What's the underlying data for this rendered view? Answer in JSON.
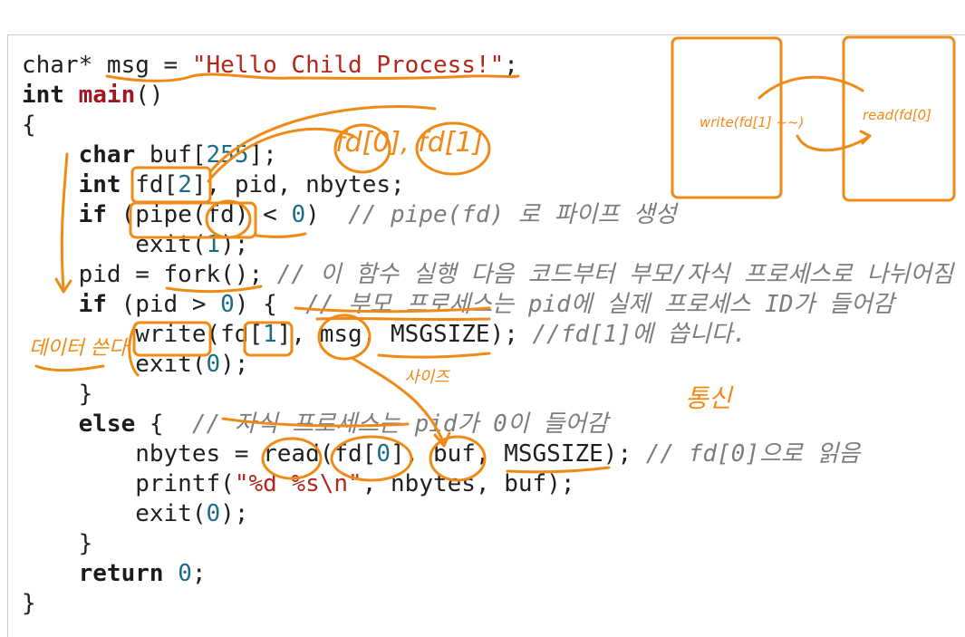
{
  "code_lines": [
    [
      {
        "t": "char* msg = ",
        "c": "kw0"
      },
      {
        "t": "\"Hello Child Process!\"",
        "c": "str"
      },
      {
        "t": ";",
        "c": ""
      }
    ],
    [
      {
        "t": "int ",
        "c": "kw"
      },
      {
        "t": "main",
        "c": "fn"
      },
      {
        "t": "()",
        "c": ""
      }
    ],
    [
      {
        "t": "{",
        "c": ""
      }
    ],
    [
      {
        "t": "    ",
        "c": ""
      },
      {
        "t": "char",
        "c": "kw"
      },
      {
        "t": " buf[",
        "c": ""
      },
      {
        "t": "255",
        "c": "num"
      },
      {
        "t": "];",
        "c": ""
      }
    ],
    [
      {
        "t": "    ",
        "c": ""
      },
      {
        "t": "int",
        "c": "kw"
      },
      {
        "t": " fd[",
        "c": ""
      },
      {
        "t": "2",
        "c": "num"
      },
      {
        "t": "], pid, nbytes;",
        "c": ""
      }
    ],
    [
      {
        "t": "    ",
        "c": ""
      },
      {
        "t": "if",
        "c": "kw"
      },
      {
        "t": " (pipe(fd) < ",
        "c": ""
      },
      {
        "t": "0",
        "c": "num"
      },
      {
        "t": ")  ",
        "c": ""
      },
      {
        "t": "// pipe(fd) 로 파이프 생성",
        "c": "cm"
      }
    ],
    [
      {
        "t": "        exit(",
        "c": "num0"
      },
      {
        "t": "1",
        "c": "num"
      },
      {
        "t": ");",
        "c": ""
      }
    ],
    [
      {
        "t": "    pid = fork(); ",
        "c": ""
      },
      {
        "t": "// 이 함수 실행 다음 코드부터 부모/자식 프로세스로 나뉘어짐",
        "c": "cm"
      }
    ],
    [
      {
        "t": "    ",
        "c": ""
      },
      {
        "t": "if",
        "c": "kw"
      },
      {
        "t": " (pid > ",
        "c": ""
      },
      {
        "t": "0",
        "c": "num"
      },
      {
        "t": ") {  ",
        "c": ""
      },
      {
        "t": "// 부모 프로세스는 pid에 실제 프로세스 ID가 들어감",
        "c": "cm"
      }
    ],
    [
      {
        "t": "        write(fd[",
        "c": "num0"
      },
      {
        "t": "1",
        "c": "num"
      },
      {
        "t": "], msg, MSGSIZE); ",
        "c": ""
      },
      {
        "t": "//fd[1]에 씁니다.",
        "c": "cm"
      }
    ],
    [
      {
        "t": "        exit(",
        "c": "num0"
      },
      {
        "t": "0",
        "c": "num"
      },
      {
        "t": ");",
        "c": ""
      }
    ],
    [
      {
        "t": "    }",
        "c": ""
      }
    ],
    [
      {
        "t": "    ",
        "c": ""
      },
      {
        "t": "else",
        "c": "kw"
      },
      {
        "t": " {  ",
        "c": ""
      },
      {
        "t": "// 자식 프로세스는 pid가 0이 들어감",
        "c": "cm"
      }
    ],
    [
      {
        "t": "        nbytes = read(fd[",
        "c": ""
      },
      {
        "t": "0",
        "c": "num"
      },
      {
        "t": "], buf, MSGSIZE); ",
        "c": ""
      },
      {
        "t": "// fd[0]으로 읽음",
        "c": "cm"
      }
    ],
    [
      {
        "t": "        printf(",
        "c": "num0"
      },
      {
        "t": "\"%d %s\\n\"",
        "c": "str"
      },
      {
        "t": ", nbytes, buf);",
        "c": ""
      }
    ],
    [
      {
        "t": "        exit(",
        "c": "num0"
      },
      {
        "t": "0",
        "c": "num"
      },
      {
        "t": ");",
        "c": ""
      }
    ],
    [
      {
        "t": "    }",
        "c": ""
      }
    ],
    [
      {
        "t": "    ",
        "c": ""
      },
      {
        "t": "return",
        "c": "kw"
      },
      {
        "t": " ",
        "c": ""
      },
      {
        "t": "0",
        "c": "num"
      },
      {
        "t": ";",
        "c": ""
      }
    ],
    [
      {
        "t": "}",
        "c": ""
      }
    ]
  ],
  "annotations": {
    "fd_labels": "fd[0], fd[1]",
    "write_note": "write(fd[1] ~~)",
    "read_note": "read(fd[0]",
    "korean_write": "데이터 쓴다",
    "size_note": "사이즈",
    "comm_note": "통신"
  },
  "colors": {
    "ink": "#f08a16",
    "keyword": "#1c1c1c",
    "string": "#b3261e",
    "number": "#1a6b8a",
    "comment": "#7d7d7d"
  }
}
